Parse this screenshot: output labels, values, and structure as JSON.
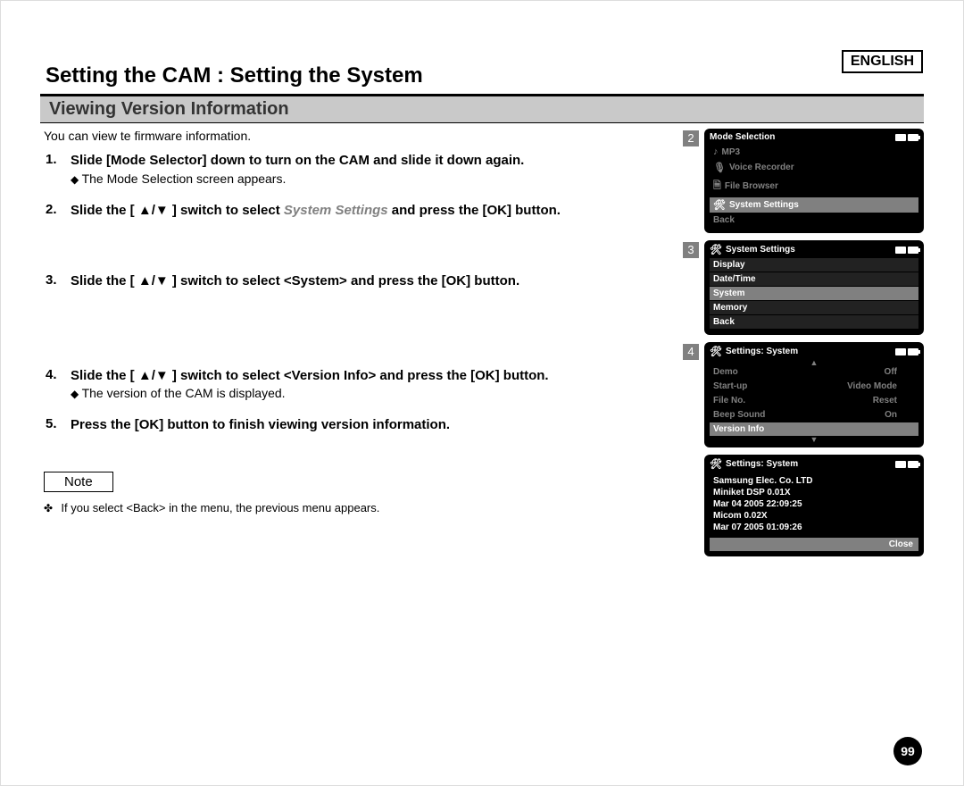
{
  "language_label": "ENGLISH",
  "page_title": "Setting the CAM : Setting the System",
  "section_title": "Viewing Version Information",
  "intro": "You can view te firmware information.",
  "steps": [
    {
      "num": "1.",
      "main_pre": "Slide [Mode Selector] down to turn on the CAM and slide it down again.",
      "main_mid": "",
      "main_post": "",
      "sub": "The Mode Selection screen appears."
    },
    {
      "num": "2.",
      "main_pre": "Slide the [ ▲/▼ ] switch to select ",
      "main_mid": "System Settings",
      "main_post": " and press the [OK] button.",
      "sub": ""
    },
    {
      "num": "3.",
      "main_pre": "Slide the [ ▲/▼ ] switch to select <System> and press the [OK] button.",
      "main_mid": "",
      "main_post": "",
      "sub": ""
    },
    {
      "num": "4.",
      "main_pre": "Slide the [ ▲/▼ ] switch to select <Version Info> and press the [OK] button.",
      "main_mid": "",
      "main_post": "",
      "sub": "The version of the CAM is displayed."
    },
    {
      "num": "5.",
      "main_pre": "Press the [OK] button to finish viewing version information.",
      "main_mid": "",
      "main_post": "",
      "sub": ""
    }
  ],
  "note_label": "Note",
  "note_line": "If you select <Back> in the menu, the previous menu appears.",
  "screens": {
    "s2": {
      "num": "2",
      "title": "Mode Selection",
      "items": [
        {
          "glyph": "♪",
          "label": "MP3",
          "sel": false
        },
        {
          "glyph": "🎙",
          "label": "Voice Recorder",
          "sel": false
        },
        {
          "glyph": "🗎",
          "label": "File Browser",
          "sel": false
        },
        {
          "glyph": "🛠",
          "label": "System Settings",
          "sel": true
        },
        {
          "glyph": "",
          "label": "Back",
          "sel": false
        }
      ]
    },
    "s3": {
      "num": "3",
      "title": "System Settings",
      "items": [
        {
          "label": "Display",
          "sel": false,
          "dark": true
        },
        {
          "label": "Date/Time",
          "sel": false,
          "dark": true
        },
        {
          "label": "System",
          "sel": true
        },
        {
          "label": "Memory",
          "sel": false,
          "dark": true
        },
        {
          "label": "Back",
          "sel": false,
          "dark": true
        }
      ]
    },
    "s4": {
      "num": "4",
      "title": "Settings: System",
      "rows": [
        {
          "label": "Demo",
          "value": "Off"
        },
        {
          "label": "Start-up",
          "value": "Video Mode"
        },
        {
          "label": "File No.",
          "value": "Reset"
        },
        {
          "label": "Beep Sound",
          "value": "On"
        }
      ],
      "selected": "Version Info"
    },
    "s5": {
      "title": "Settings: System",
      "lines": [
        "Samsung Elec. Co. LTD",
        "Miniket DSP 0.01X",
        "Mar 04 2005 22:09:25",
        "Micom 0.02X",
        "Mar 07 2005 01:09:26"
      ],
      "close": "Close"
    }
  },
  "page_number": "99"
}
